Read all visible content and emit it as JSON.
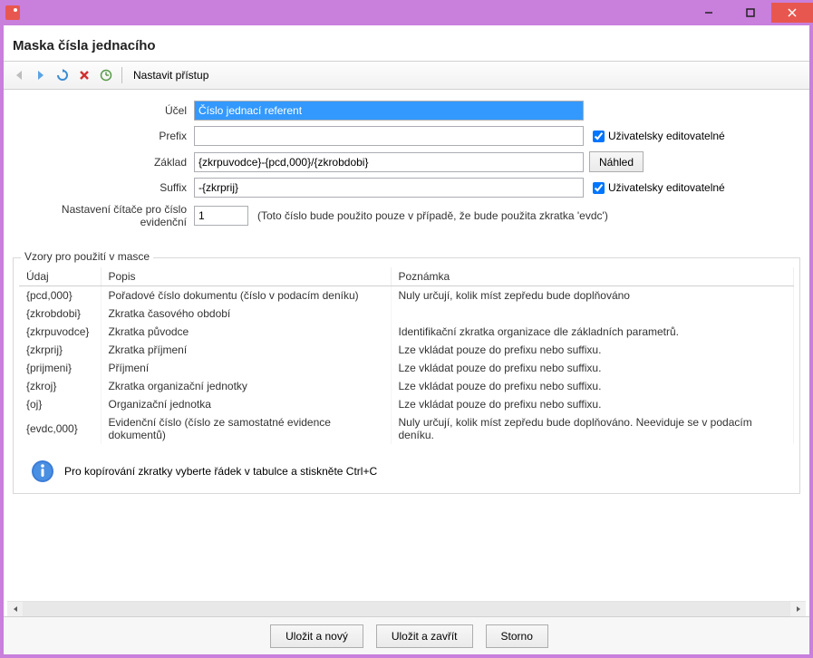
{
  "header": {
    "title": "Maska čísla jednacího"
  },
  "toolbar": {
    "access": "Nastavit přístup"
  },
  "form": {
    "purpose_label": "Účel",
    "purpose_value": "Číslo jednací referent",
    "prefix_label": "Prefix",
    "prefix_value": "",
    "prefix_chk": "Uživatelsky editovatelné",
    "base_label": "Základ",
    "base_value": "{zkrpuvodce}-{pcd,000}/{zkrobdobi}",
    "base_btn": "Náhled",
    "suffix_label": "Suffix",
    "suffix_value": "-{zkrprij}",
    "suffix_chk": "Uživatelsky editovatelné",
    "counter_label": "Nastavení čítače pro číslo evidenční",
    "counter_value": "1",
    "counter_hint": "(Toto číslo bude použito pouze v případě, že bude použita zkratka 'evdc')"
  },
  "group": {
    "title": "Vzory pro použití v masce"
  },
  "table": {
    "cols": {
      "udaj": "Údaj",
      "popis": "Popis",
      "pozn": "Poznámka"
    },
    "rows": [
      {
        "udaj": "{pcd,000}",
        "popis": "Pořadové číslo dokumentu (číslo v podacím deníku)",
        "pozn": "Nuly určují, kolik míst zepředu bude doplňováno"
      },
      {
        "udaj": "{zkrobdobi}",
        "popis": "Zkratka časového období",
        "pozn": ""
      },
      {
        "udaj": "{zkrpuvodce}",
        "popis": "Zkratka původce",
        "pozn": "Identifikační zkratka organizace dle základních parametrů."
      },
      {
        "udaj": "{zkrprij}",
        "popis": "Zkratka příjmení",
        "pozn": "Lze vkládat pouze do prefixu nebo suffixu."
      },
      {
        "udaj": "{prijmeni}",
        "popis": "Příjmení",
        "pozn": "Lze vkládat pouze do prefixu nebo suffixu."
      },
      {
        "udaj": "{zkroj}",
        "popis": "Zkratka organizační jednotky",
        "pozn": "Lze vkládat pouze do prefixu nebo suffixu."
      },
      {
        "udaj": "{oj}",
        "popis": "Organizační jednotka",
        "pozn": "Lze vkládat pouze do prefixu nebo suffixu."
      },
      {
        "udaj": "{evdc,000}",
        "popis": "Evidenční číslo (číslo ze samostatné evidence dokumentů)",
        "pozn": "Nuly určují, kolik míst zepředu bude doplňováno. Neeviduje se v podacím deníku."
      }
    ]
  },
  "info": {
    "text": "Pro kopírování zkratky vyberte řádek v tabulce a stiskněte Ctrl+C"
  },
  "footer": {
    "save_new": "Uložit a nový",
    "save_close": "Uložit a zavřít",
    "cancel": "Storno"
  }
}
